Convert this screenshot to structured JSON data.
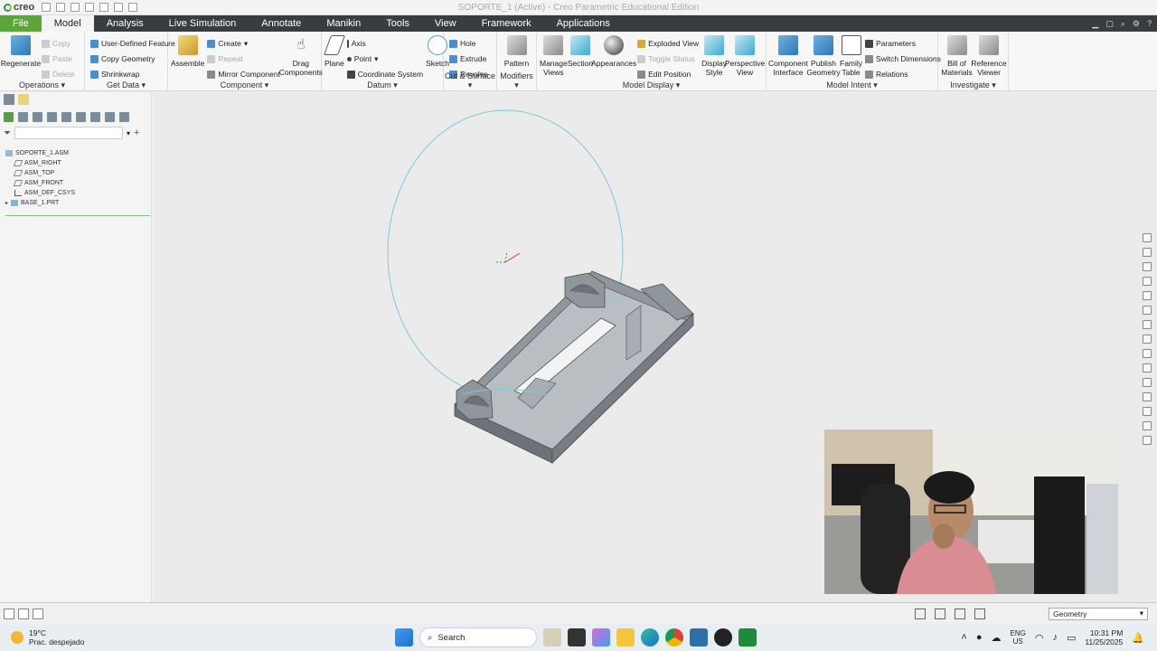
{
  "window": {
    "title": "SOPORTE_1 (Active) - Creo Parametric Educational Edition",
    "logo": "creo"
  },
  "menu": {
    "tabs": [
      "File",
      "Model",
      "Analysis",
      "Live Simulation",
      "Annotate",
      "Manikin",
      "Tools",
      "View",
      "Framework",
      "Applications"
    ],
    "active": "Model"
  },
  "ribbon": {
    "operations": {
      "label": "Operations",
      "regenerate": "Regenerate",
      "copy": "Copy",
      "paste": "Paste",
      "delete": "Delete"
    },
    "get_data": {
      "label": "Get Data",
      "udf": "User-Defined Feature",
      "copy_geometry": "Copy Geometry",
      "shrinkwrap": "Shrinkwrap"
    },
    "component": {
      "label": "Component",
      "assemble": "Assemble",
      "create": "Create",
      "repeat": "Repeat",
      "mirror": "Mirror Component",
      "drag": "Drag Components"
    },
    "datum": {
      "label": "Datum",
      "plane": "Plane",
      "axis": "Axis",
      "point": "Point",
      "csys": "Coordinate System",
      "sketch": "Sketch"
    },
    "cut_surface": {
      "label": "Cut & Surface",
      "hole": "Hole",
      "extrude": "Extrude",
      "revolve": "Revolve"
    },
    "modifiers": {
      "label": "Modifiers",
      "pattern": "Pattern"
    },
    "model_display": {
      "label": "Model Display",
      "manage_views": "Manage Views",
      "section": "Section",
      "appearances": "Appearances",
      "exploded": "Exploded View",
      "toggle_status": "Toggle Status",
      "edit_position": "Edit Position",
      "display_style": "Display Style",
      "perspective": "Perspective View"
    },
    "model_intent": {
      "label": "Model Intent",
      "component_interface": "Component Interface",
      "publish_geometry": "Publish Geometry",
      "family_table": "Family Table",
      "parameters": "Parameters",
      "switch_dimensions": "Switch Dimensions",
      "relations": "Relations"
    },
    "investigate": {
      "label": "Investigate",
      "bom": "Bill of Materials",
      "reference_viewer": "Reference Viewer"
    }
  },
  "tree": {
    "root": "SOPORTE_1.ASM",
    "items": [
      "ASM_RIGHT",
      "ASM_TOP",
      "ASM_FRONT",
      "ASM_DEF_CSYS",
      "BASE_1.PRT"
    ]
  },
  "statusbar": {
    "filter": "Geometry"
  },
  "taskbar": {
    "weather_temp": "19°C",
    "weather_desc": "Prac. despejado",
    "search": "Search",
    "lang1": "ENG",
    "lang2": "US",
    "time": "10:31 PM",
    "date": "11/25/2025"
  },
  "colors": {
    "menubar": "#3a3d3f",
    "file_tab": "#5ca53a",
    "model": "#8f969c",
    "sketch_circle": "#7fc9d9"
  }
}
